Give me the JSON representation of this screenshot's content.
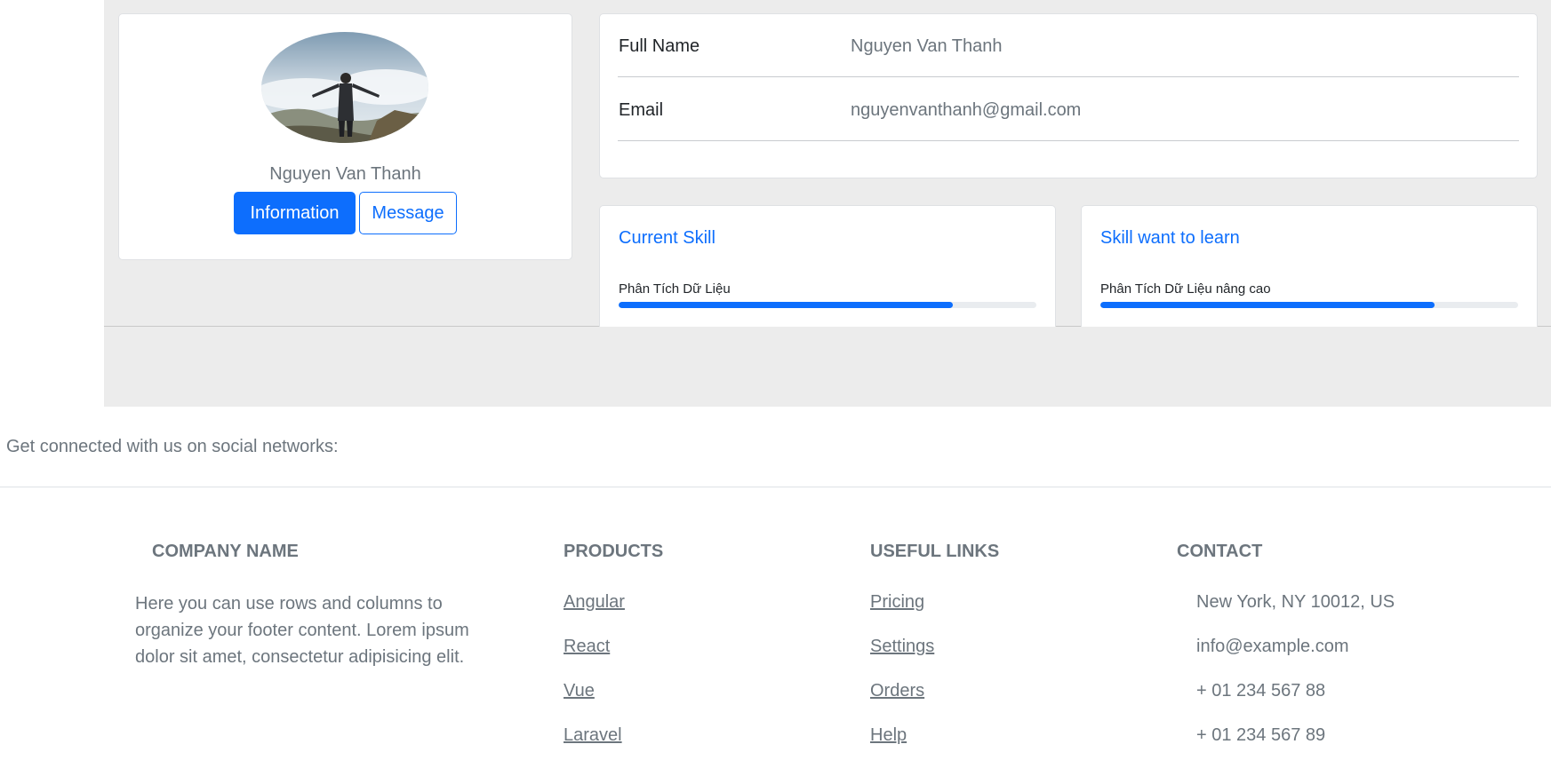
{
  "profile": {
    "name": "Nguyen Van Thanh",
    "information_button": "Information",
    "message_button": "Message"
  },
  "details": [
    {
      "label": "Full Name",
      "value": "Nguyen Van Thanh"
    },
    {
      "label": "Email",
      "value": "nguyenvanthanh@gmail.com"
    }
  ],
  "current_skill": {
    "title": "Current Skill",
    "skill": "Phân Tích Dữ Liệu",
    "progress": 0.8
  },
  "learn_skill": {
    "title": "Skill want to learn",
    "skill": "Phân Tích Dữ Liệu nâng cao",
    "progress": 0.8
  },
  "footer": {
    "social_text": "Get connected with us on social networks:",
    "company": {
      "heading": "Company name",
      "description": "Here you can use rows and columns to organize your footer content. Lorem ipsum dolor sit amet, consectetur adipisicing elit."
    },
    "products": {
      "heading": "Products",
      "links": [
        "Angular",
        "React",
        "Vue",
        "Laravel"
      ]
    },
    "useful_links": {
      "heading": "Useful links",
      "links": [
        "Pricing",
        "Settings",
        "Orders",
        "Help"
      ]
    },
    "contact": {
      "heading": "Contact",
      "items": [
        "New York, NY 10012, US",
        "info@example.com",
        "+ 01 234 567 88",
        "+ 01 234 567 89"
      ]
    }
  },
  "colors": {
    "primary": "#0d6efd",
    "muted_text": "#6c757d",
    "page_gray": "#ececec"
  }
}
